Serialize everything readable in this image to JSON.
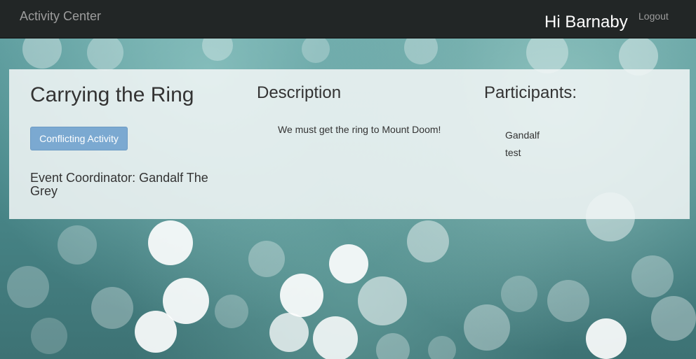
{
  "navbar": {
    "brand": "Activity Center",
    "greeting": "Hi Barnaby",
    "logout_label": "Logout"
  },
  "activity": {
    "title": "Carrying the Ring",
    "status_button_label": "Conflicting Activity",
    "coordinator": "Event Coordinator: Gandalf The Grey",
    "description_heading": "Description",
    "description": "We must get the ring to Mount Doom!",
    "participants_heading": "Participants:",
    "participants": [
      "Gandalf",
      "test"
    ]
  },
  "colors": {
    "navbar_bg": "#222626",
    "button_bg": "#7ba9d1",
    "panel_bg": "#f0f5f5"
  }
}
